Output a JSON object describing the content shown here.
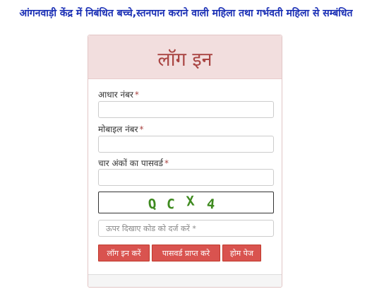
{
  "header": {
    "title": "आंगनवाड़ी केंद्र में निबंधित बच्चे,स्तनपान कराने वाली महिला तथा गर्भवती महिला से सम्बंधित"
  },
  "login": {
    "heading": "लॉग इन",
    "required_mark": "*",
    "aadhaar_label": "आधार नंबर",
    "aadhaar_value": "",
    "mobile_label": "मोबाइल नंबर",
    "mobile_value": "",
    "password_label": "चार अंकों का पासवर्ड",
    "password_value": "",
    "captcha_chars": [
      "Q",
      "C",
      "X",
      "4"
    ],
    "captcha_input_placeholder": "ऊपर दिखाए कोड को दर्ज करें *",
    "buttons": {
      "login": "लॉग इन करें",
      "get_password": "पासवर्ड प्राप्त करे",
      "home": "होम पेज"
    }
  },
  "colors": {
    "title": "#1a2fb5",
    "heading": "#a94442",
    "heading_bg": "#f2dede",
    "button_bg": "#d9534f",
    "captcha": "#3e8a1f"
  }
}
